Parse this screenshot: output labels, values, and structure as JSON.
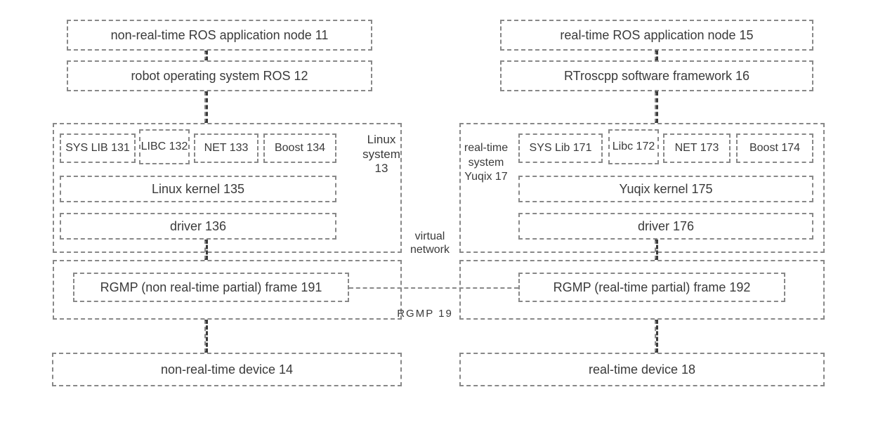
{
  "left": {
    "app_node": "non-real-time ROS application node 11",
    "ros": "robot operating system ROS 12",
    "linux_label": "Linux system 13",
    "syslib": "SYS LIB 131",
    "libc": "LIBC 132",
    "net": "NET 133",
    "boost": "Boost 134",
    "kernel": "Linux kernel 135",
    "driver": "driver 136",
    "rgmp": "RGMP (non real-time partial) frame 191",
    "device": "non-real-time device 14"
  },
  "right": {
    "app_node": "real-time ROS application node 15",
    "framework": "RTroscpp software framework 16",
    "yuqix_label": "real-time system Yuqix 17",
    "syslib": "SYS Lib 171",
    "libc": "Libc 172",
    "net": "NET 173",
    "boost": "Boost 174",
    "kernel": "Yuqix kernel 175",
    "driver": "driver 176",
    "rgmp": "RGMP (real-time partial) frame 192",
    "device": "real-time device 18"
  },
  "mid": {
    "virtual_network": "virtual network",
    "rgmp_label": "RGMP  19"
  }
}
